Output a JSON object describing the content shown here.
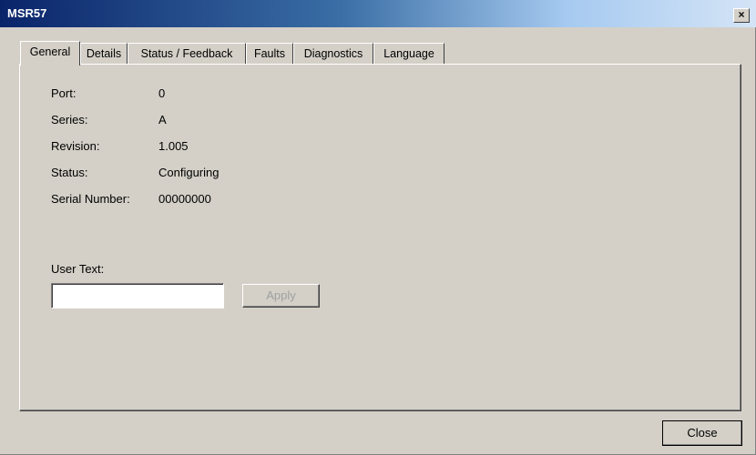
{
  "window": {
    "title": "MSR57",
    "close_glyph": "×"
  },
  "tabs": [
    {
      "label": "General",
      "active": true
    },
    {
      "label": "Details",
      "active": false
    },
    {
      "label": "Status / Feedback",
      "active": false
    },
    {
      "label": "Faults",
      "active": false
    },
    {
      "label": "Diagnostics",
      "active": false
    },
    {
      "label": "Language",
      "active": false
    }
  ],
  "general": {
    "port_label": "Port:",
    "port_value": "0",
    "series_label": "Series:",
    "series_value": "A",
    "revision_label": "Revision:",
    "revision_value": "1.005",
    "status_label": "Status:",
    "status_value": "Configuring",
    "serial_label": "Serial Number:",
    "serial_value": "00000000",
    "user_text_label": "User Text:",
    "user_text_value": "",
    "apply_label": "Apply",
    "apply_enabled": false
  },
  "footer": {
    "close_label": "Close"
  },
  "colors": {
    "face": "#d4d0c8",
    "title_gradient_start": "#0a246a",
    "title_gradient_end": "#d4e4f6",
    "disabled_text": "#a0a0a0"
  }
}
